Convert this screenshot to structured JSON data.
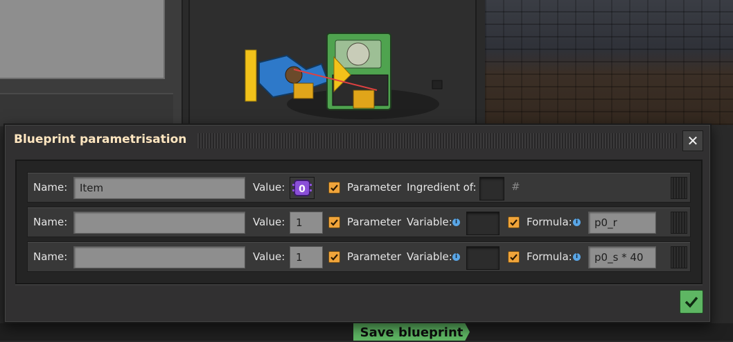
{
  "dialog": {
    "title": "Blueprint parametrisation",
    "close_icon": "close-icon"
  },
  "rows": [
    {
      "name_label": "Name:",
      "name_value": "Item",
      "value_label": "Value:",
      "value_display": "0",
      "parameter_label": "Parameter",
      "parameter_checked": true,
      "extra_label": "Ingredient of:",
      "extra_icon": "hash-icon",
      "extra_symbol": "#"
    },
    {
      "name_label": "Name:",
      "name_value": "",
      "value_label": "Value:",
      "value_display": "1",
      "parameter_label": "Parameter",
      "parameter_checked": true,
      "variable_label": "Variable:",
      "formula_checked": true,
      "formula_label": "Formula:",
      "formula_value": "p0_r"
    },
    {
      "name_label": "Name:",
      "name_value": "",
      "value_label": "Value:",
      "value_display": "1",
      "parameter_label": "Parameter",
      "parameter_checked": true,
      "variable_label": "Variable:",
      "formula_checked": true,
      "formula_label": "Formula:",
      "formula_value": "p0_s * 40"
    }
  ],
  "info_icon": "i",
  "footer": {
    "confirm_icon": "checkmark-icon",
    "save_blueprint_label": "Save blueprint"
  },
  "colors": {
    "accent_orange": "#f0a43a",
    "confirm_green": "#5eb663",
    "title_text": "#ffe6c0",
    "parameter_purple": "#8a4fd8"
  }
}
